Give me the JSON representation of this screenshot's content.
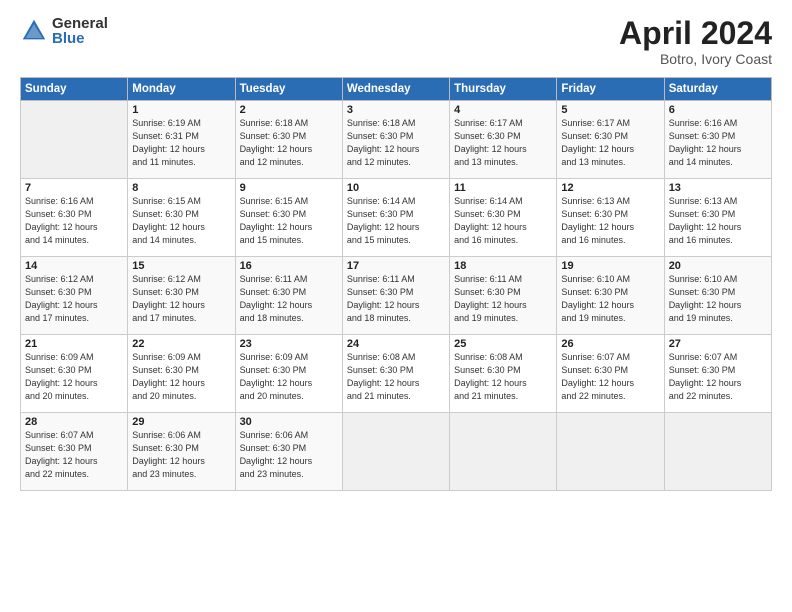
{
  "logo": {
    "general": "General",
    "blue": "Blue"
  },
  "title": "April 2024",
  "subtitle": "Botro, Ivory Coast",
  "days_of_week": [
    "Sunday",
    "Monday",
    "Tuesday",
    "Wednesday",
    "Thursday",
    "Friday",
    "Saturday"
  ],
  "weeks": [
    [
      {
        "num": "",
        "info": ""
      },
      {
        "num": "1",
        "info": "Sunrise: 6:19 AM\nSunset: 6:31 PM\nDaylight: 12 hours\nand 11 minutes."
      },
      {
        "num": "2",
        "info": "Sunrise: 6:18 AM\nSunset: 6:30 PM\nDaylight: 12 hours\nand 12 minutes."
      },
      {
        "num": "3",
        "info": "Sunrise: 6:18 AM\nSunset: 6:30 PM\nDaylight: 12 hours\nand 12 minutes."
      },
      {
        "num": "4",
        "info": "Sunrise: 6:17 AM\nSunset: 6:30 PM\nDaylight: 12 hours\nand 13 minutes."
      },
      {
        "num": "5",
        "info": "Sunrise: 6:17 AM\nSunset: 6:30 PM\nDaylight: 12 hours\nand 13 minutes."
      },
      {
        "num": "6",
        "info": "Sunrise: 6:16 AM\nSunset: 6:30 PM\nDaylight: 12 hours\nand 14 minutes."
      }
    ],
    [
      {
        "num": "7",
        "info": "Sunrise: 6:16 AM\nSunset: 6:30 PM\nDaylight: 12 hours\nand 14 minutes."
      },
      {
        "num": "8",
        "info": "Sunrise: 6:15 AM\nSunset: 6:30 PM\nDaylight: 12 hours\nand 14 minutes."
      },
      {
        "num": "9",
        "info": "Sunrise: 6:15 AM\nSunset: 6:30 PM\nDaylight: 12 hours\nand 15 minutes."
      },
      {
        "num": "10",
        "info": "Sunrise: 6:14 AM\nSunset: 6:30 PM\nDaylight: 12 hours\nand 15 minutes."
      },
      {
        "num": "11",
        "info": "Sunrise: 6:14 AM\nSunset: 6:30 PM\nDaylight: 12 hours\nand 16 minutes."
      },
      {
        "num": "12",
        "info": "Sunrise: 6:13 AM\nSunset: 6:30 PM\nDaylight: 12 hours\nand 16 minutes."
      },
      {
        "num": "13",
        "info": "Sunrise: 6:13 AM\nSunset: 6:30 PM\nDaylight: 12 hours\nand 16 minutes."
      }
    ],
    [
      {
        "num": "14",
        "info": "Sunrise: 6:12 AM\nSunset: 6:30 PM\nDaylight: 12 hours\nand 17 minutes."
      },
      {
        "num": "15",
        "info": "Sunrise: 6:12 AM\nSunset: 6:30 PM\nDaylight: 12 hours\nand 17 minutes."
      },
      {
        "num": "16",
        "info": "Sunrise: 6:11 AM\nSunset: 6:30 PM\nDaylight: 12 hours\nand 18 minutes."
      },
      {
        "num": "17",
        "info": "Sunrise: 6:11 AM\nSunset: 6:30 PM\nDaylight: 12 hours\nand 18 minutes."
      },
      {
        "num": "18",
        "info": "Sunrise: 6:11 AM\nSunset: 6:30 PM\nDaylight: 12 hours\nand 19 minutes."
      },
      {
        "num": "19",
        "info": "Sunrise: 6:10 AM\nSunset: 6:30 PM\nDaylight: 12 hours\nand 19 minutes."
      },
      {
        "num": "20",
        "info": "Sunrise: 6:10 AM\nSunset: 6:30 PM\nDaylight: 12 hours\nand 19 minutes."
      }
    ],
    [
      {
        "num": "21",
        "info": "Sunrise: 6:09 AM\nSunset: 6:30 PM\nDaylight: 12 hours\nand 20 minutes."
      },
      {
        "num": "22",
        "info": "Sunrise: 6:09 AM\nSunset: 6:30 PM\nDaylight: 12 hours\nand 20 minutes."
      },
      {
        "num": "23",
        "info": "Sunrise: 6:09 AM\nSunset: 6:30 PM\nDaylight: 12 hours\nand 20 minutes."
      },
      {
        "num": "24",
        "info": "Sunrise: 6:08 AM\nSunset: 6:30 PM\nDaylight: 12 hours\nand 21 minutes."
      },
      {
        "num": "25",
        "info": "Sunrise: 6:08 AM\nSunset: 6:30 PM\nDaylight: 12 hours\nand 21 minutes."
      },
      {
        "num": "26",
        "info": "Sunrise: 6:07 AM\nSunset: 6:30 PM\nDaylight: 12 hours\nand 22 minutes."
      },
      {
        "num": "27",
        "info": "Sunrise: 6:07 AM\nSunset: 6:30 PM\nDaylight: 12 hours\nand 22 minutes."
      }
    ],
    [
      {
        "num": "28",
        "info": "Sunrise: 6:07 AM\nSunset: 6:30 PM\nDaylight: 12 hours\nand 22 minutes."
      },
      {
        "num": "29",
        "info": "Sunrise: 6:06 AM\nSunset: 6:30 PM\nDaylight: 12 hours\nand 23 minutes."
      },
      {
        "num": "30",
        "info": "Sunrise: 6:06 AM\nSunset: 6:30 PM\nDaylight: 12 hours\nand 23 minutes."
      },
      {
        "num": "",
        "info": ""
      },
      {
        "num": "",
        "info": ""
      },
      {
        "num": "",
        "info": ""
      },
      {
        "num": "",
        "info": ""
      }
    ]
  ]
}
